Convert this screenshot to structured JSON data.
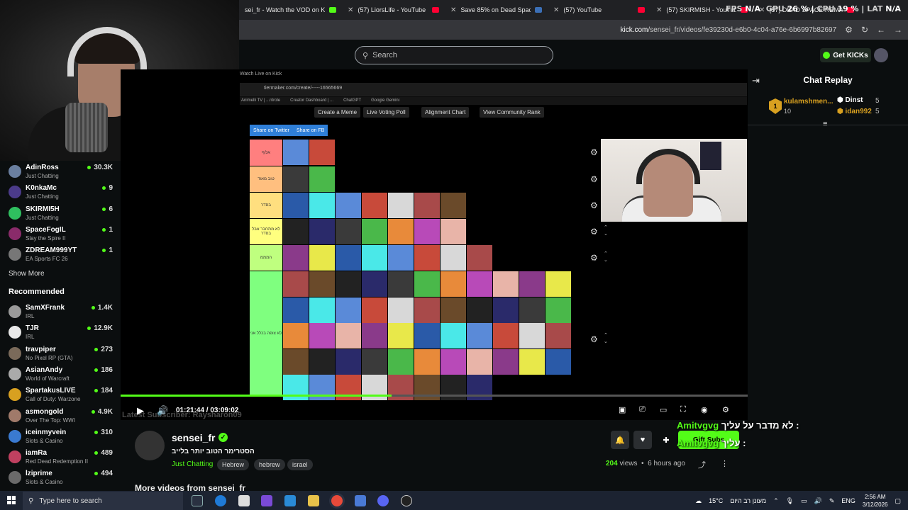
{
  "browser": {
    "tabs": [
      {
        "label": "sei_fr - Watch the VOD on K",
        "color": "#53fc18"
      },
      {
        "label": "(57) LiorsLife - YouTube",
        "color": "#ff0033"
      },
      {
        "label": "Save 85% on Dead Space on St",
        "color": "#3b6fb6"
      },
      {
        "label": "(57) YouTube",
        "color": "#ff0033"
      },
      {
        "label": "(57) SKIRMISH - YouTube",
        "color": "#ff0033"
      },
      {
        "label": "(57) DEAD SPACE REMAKE PS5",
        "color": "#ff0033"
      }
    ],
    "url_domain": "kick.com",
    "url_path": "/sensei_fr/videos/fe39230d-e6b0-4c04-a76e-6b6997b82697"
  },
  "overlay_stats": {
    "fps_label": "FPS",
    "fps_value": "N/A",
    "gpu_label": "GPU",
    "gpu_value": "26 %",
    "cpu_label": "CPU",
    "cpu_value": "19 %",
    "lat_label": "LAT",
    "lat_value": "N/A"
  },
  "header": {
    "search_placeholder": "Search",
    "kicks_label": "Get KICKs"
  },
  "sidebar": {
    "following": [
      {
        "name": "AdinRoss",
        "category": "Just Chatting",
        "viewers": "30.3K",
        "color": "#6a7fa0"
      },
      {
        "name": "K0nkaMc",
        "category": "Just Chatting",
        "viewers": "9",
        "color": "#4b3b8a"
      },
      {
        "name": "SKIRMI5H",
        "category": "Just Chatting",
        "viewers": "6",
        "color": "#2fbf5f"
      },
      {
        "name": "SpaceFogIL",
        "category": "Slay the Spire II",
        "viewers": "1",
        "color": "#8a2b6a"
      },
      {
        "name": "ZDREAM999YT",
        "category": "EA Sports FC 26",
        "viewers": "1",
        "color": "#777777"
      }
    ],
    "show_more": "Show More",
    "recommended_title": "Recommended",
    "recommended": [
      {
        "name": "SamXFrank",
        "category": "IRL",
        "viewers": "1.4K",
        "color": "#9a9a9a"
      },
      {
        "name": "TJR",
        "category": "IRL",
        "viewers": "12.9K",
        "color": "#e8e8e8"
      },
      {
        "name": "travpiper",
        "category": "No Pixel RP (GTA)",
        "viewers": "273",
        "color": "#7a6a5a"
      },
      {
        "name": "AsianAndy",
        "category": "World of Warcraft",
        "viewers": "186",
        "color": "#aaaaaa"
      },
      {
        "name": "SpartakusLIVE",
        "category": "Call of Duty: Warzone",
        "viewers": "184",
        "color": "#d8a020"
      },
      {
        "name": "asmongold",
        "category": "Over The Top: WWI",
        "viewers": "4.9K",
        "color": "#a07a6a"
      },
      {
        "name": "iceinmyvein",
        "category": "Slots & Casino",
        "viewers": "310",
        "color": "#3a7ad0"
      },
      {
        "name": "iamRa",
        "category": "Red Dead Redemption II",
        "viewers": "489",
        "color": "#c04060"
      },
      {
        "name": "lziprime",
        "category": "Slots & Casino",
        "viewers": "494",
        "color": "#6a6a6a"
      }
    ]
  },
  "video": {
    "inner_title": "Watch Live on Kick",
    "inner_url": "tiermaker.com/create/-----16565669",
    "bookmarks": [
      "Animelli TV | ...ntrole",
      "Creator Dashboard | ...",
      "ChatGPT",
      "Google Gemini"
    ],
    "tier_buttons": [
      "Create a Meme",
      "Live Voting Poll",
      "Alignment Chart",
      "View Community Rank"
    ],
    "share_buttons": [
      "Share on Twitter",
      "Share on FB"
    ],
    "tiers": [
      {
        "label": "אלוף",
        "color": "#ff7f7f",
        "tiles": 2
      },
      {
        "label": "טוב מאוד",
        "color": "#ffbf7f",
        "tiles": 2
      },
      {
        "label": "בסדר",
        "color": "#ffdf7f",
        "tiles": 7
      },
      {
        "label": "לא מתחבר אבל בסדר",
        "color": "#ffff7f",
        "tiles": 7
      },
      {
        "label": "המממ",
        "color": "#bfff7f",
        "tiles": 8
      },
      {
        "label": "לא צופה בכלל אני",
        "color": "#7fff7f",
        "tiles": 12
      }
    ],
    "current_time": "01:21:44",
    "duration": "03:09:02",
    "progress": 0.4326,
    "latest_sub": "Latest Subscriber: Raysharon09"
  },
  "chat": {
    "title": "Chat Replay",
    "leaderboard": [
      {
        "rank": "1",
        "name": "kulamshmen...",
        "points": "10"
      },
      {
        "name": "Dinst",
        "points": "5"
      },
      {
        "name": "idan992",
        "points": "5"
      }
    ]
  },
  "stream_info": {
    "streamer": "sensei_fr",
    "title": "הסטרימר הטוב יותר בלייב",
    "category": "Just Chatting",
    "tags": [
      "Hebrew",
      "hebrew",
      "israel"
    ],
    "views_count": "204",
    "views_label": "views",
    "posted": "6 hours ago",
    "gift_label": "Gift Subs",
    "overlay_line1_user": "Amitvgvg",
    "overlay_line1_msg": "לא מדבר על עליך :",
    "overlay_line2_user": "Amitvgvg",
    "overlay_line2_msg": "עליך :",
    "more_videos": "More videos from sensei_fr"
  },
  "taskbar": {
    "search_placeholder": "Type here to search",
    "weather_temp": "15°C",
    "weather_desc": "מעונן רב היום",
    "lang": "ENG",
    "time": "2:56 AM",
    "date": "3/12/2026"
  }
}
